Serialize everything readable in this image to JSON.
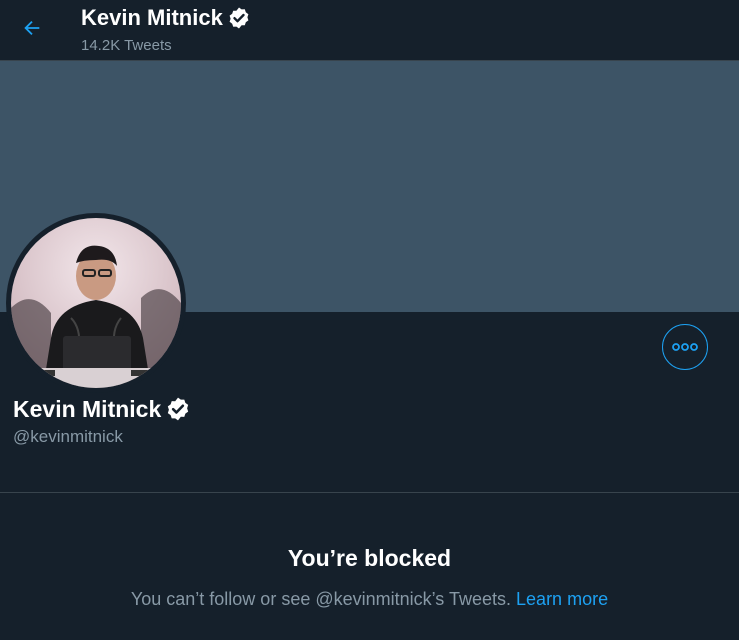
{
  "header": {
    "name": "Kevin Mitnick",
    "tweet_count": "14.2K Tweets",
    "back_icon": "arrow-left-icon"
  },
  "profile": {
    "name": "Kevin Mitnick",
    "handle": "@kevinmitnick",
    "verified_icon": "verified-badge-icon",
    "more_icon": "more-dots-icon"
  },
  "blocked": {
    "title": "You’re blocked",
    "message": "You can’t follow or see @kevinmitnick’s Tweets.",
    "link": "Learn more"
  },
  "colors": {
    "background": "#15202b",
    "banner": "#3d5466",
    "accent": "#1da1f2",
    "secondary_text": "#8899a6",
    "divider": "#38444d"
  }
}
